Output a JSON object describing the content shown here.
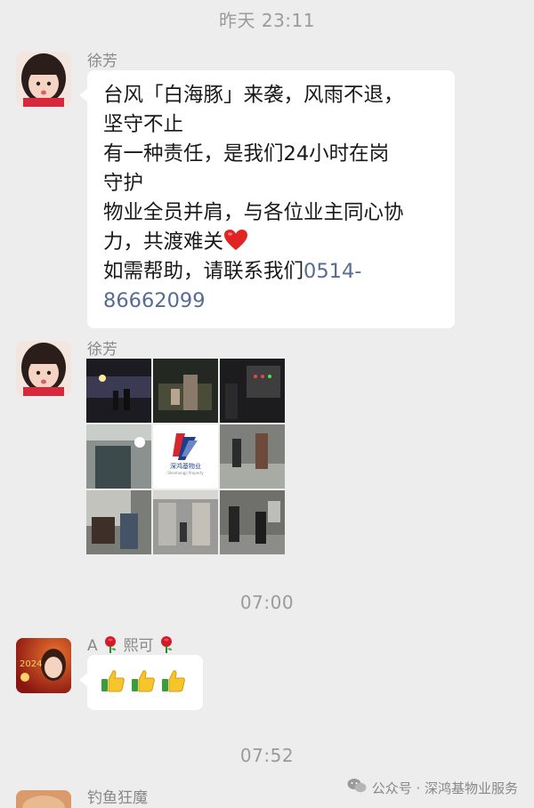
{
  "timestamps": {
    "t1": "昨天 23:11",
    "t2": "07:00",
    "t3": "07:52"
  },
  "messages": [
    {
      "sender": "徐芳",
      "lines": [
        "台风「白海豚」来袭，风雨不退，",
        "坚守不止",
        "有一种责任，是我们24小时在岗",
        "守护",
        "物业全员并肩，与各位业主同心协",
        "力，共渡难关",
        "如需帮助，请联系我们",
        "0514-",
        "86662099"
      ]
    },
    {
      "sender": "徐芳",
      "image_grid": {
        "logo_title": "深鸿基物业",
        "logo_sub": "Shenhongji Property"
      }
    },
    {
      "sender_prefix": "A",
      "sender_name": "熙可",
      "reaction": "thumbs-up x3",
      "avatar_text": "2024"
    },
    {
      "sender": "钓鱼狂魔"
    }
  ],
  "watermark": "公众号 · 深鸿基物业服务",
  "colors": {
    "background": "#ededed",
    "bubble": "#ffffff",
    "link": "#576b95",
    "timestamp": "#9b9b9b"
  }
}
